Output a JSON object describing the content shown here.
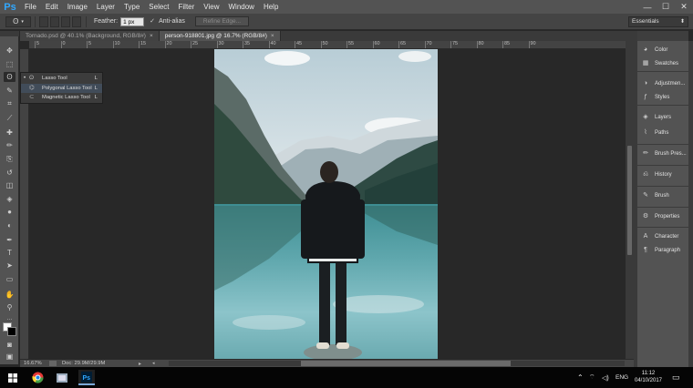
{
  "app": {
    "logo": "Ps",
    "menu": [
      "File",
      "Edit",
      "Image",
      "Layer",
      "Type",
      "Select",
      "Filter",
      "View",
      "Window",
      "Help"
    ],
    "window_controls": [
      "—",
      "☐",
      "✕"
    ]
  },
  "options_bar": {
    "feather_label": "Feather:",
    "feather_value": "1 px",
    "antialias_label": "Anti-alias",
    "antialias_checked": true,
    "refine_edge_label": "Refine Edge...",
    "workspace": "Essentials"
  },
  "tabs": [
    {
      "label": "Tornado.psd @ 40.1% (Background, RGB/8#)",
      "close": "×",
      "active": false
    },
    {
      "label": "person-918801.jpg @ 16.7% (RGB/8#)",
      "close": "×",
      "active": true
    }
  ],
  "ruler_ticks": [
    "5",
    "0",
    "5",
    "10",
    "15",
    "20",
    "25",
    "30",
    "35",
    "40",
    "45",
    "50",
    "55",
    "60",
    "65",
    "70",
    "75",
    "80",
    "85",
    "90"
  ],
  "flyout": {
    "items": [
      {
        "label": "Lasso Tool",
        "key": "L",
        "selected": true
      },
      {
        "label": "Polygonal Lasso Tool",
        "key": "L",
        "selected": false
      },
      {
        "label": "Magnetic Lasso Tool",
        "key": "L",
        "selected": false
      }
    ]
  },
  "status": {
    "zoom": "16.67%",
    "doc": "Doc: 29.9M/29.9M"
  },
  "panels": [
    {
      "label": "Color",
      "icon": "color-icon"
    },
    {
      "label": "Swatches",
      "icon": "swatches-icon"
    },
    {
      "label": "Adjustmen...",
      "icon": "adjustments-icon"
    },
    {
      "label": "Styles",
      "icon": "styles-icon"
    },
    {
      "label": "Layers",
      "icon": "layers-icon"
    },
    {
      "label": "Paths",
      "icon": "paths-icon"
    },
    {
      "label": "Brush Pres...",
      "icon": "brush-presets-icon"
    },
    {
      "label": "History",
      "icon": "history-icon"
    },
    {
      "label": "Brush",
      "icon": "brush-icon"
    },
    {
      "label": "Properties",
      "icon": "properties-icon"
    },
    {
      "label": "Character",
      "icon": "character-icon"
    },
    {
      "label": "Paragraph",
      "icon": "paragraph-icon"
    }
  ],
  "taskbar": {
    "language": "ENG",
    "time": "11:12",
    "date": "04/10/2017"
  },
  "colors": {
    "ps_blue": "#31a8ff",
    "chrome": "#535353",
    "canvas_bg": "#282828"
  }
}
